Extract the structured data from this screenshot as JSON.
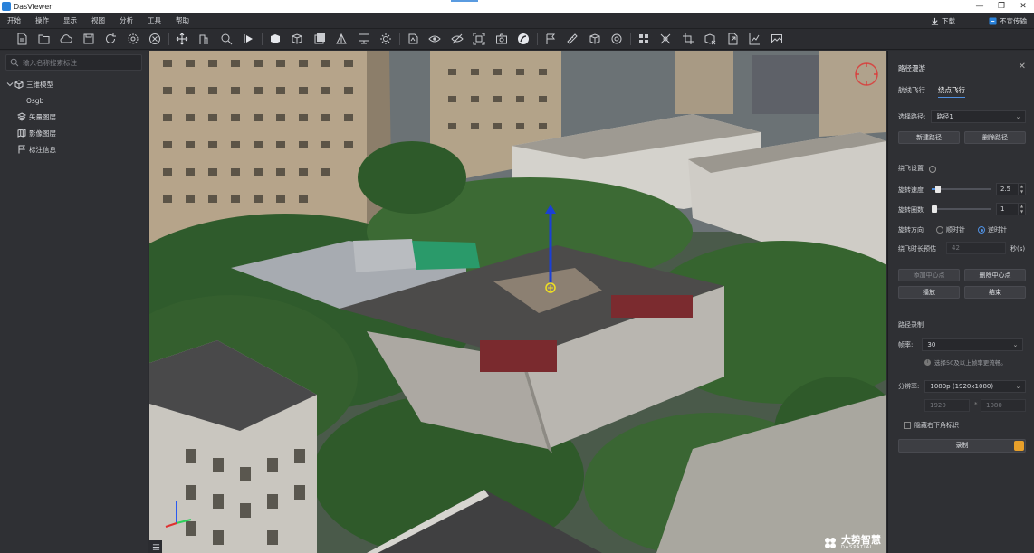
{
  "app": {
    "title": "DasViewer"
  },
  "menu": {
    "items": [
      "开始",
      "操作",
      "显示",
      "视图",
      "分析",
      "工具",
      "帮助"
    ],
    "download_label": "下载",
    "no_border_label": "不宣传输"
  },
  "toolbar": {
    "icons": [
      "new-file-icon",
      "open-folder-icon",
      "cloud-icon",
      "save-icon",
      "refresh-icon",
      "settings-icon",
      "close-circle-icon",
      "move-icon",
      "measure-building-icon",
      "zoom-icon",
      "play-path-icon",
      "cube-solid-icon",
      "cube-wire-icon",
      "cube-layers-icon",
      "pyramid-icon",
      "monitor-icon",
      "light-icon",
      "rotate-icon",
      "view-eye-icon",
      "view-hide-icon",
      "frame-icon",
      "camera-icon",
      "fly-path-icon",
      "flag-icon",
      "ruler-icon",
      "volume-icon",
      "target-icon",
      "grid-icon",
      "clip-icon",
      "crop-icon",
      "box-cut-icon",
      "export-icon",
      "chart-icon",
      "image-icon"
    ]
  },
  "left_panel": {
    "search_placeholder": "输入名称搜索标注",
    "tree": {
      "root": "三维模型",
      "child": "Osgb",
      "vector": "矢量图层",
      "imagery": "影像图层",
      "annotations": "标注信息"
    }
  },
  "viewport": {
    "watermark_main": "大势智慧",
    "watermark_sub": "DASPATIAL"
  },
  "right_panel": {
    "title": "路径漫游",
    "tabs": [
      "航线飞行",
      "绕点飞行"
    ],
    "active_tab": 1,
    "path_select_label": "选择路径:",
    "path_select_value": "路径1",
    "new_path": "新建路径",
    "delete_path": "删除路径",
    "fly_settings": "绕飞设置",
    "rotate_speed_label": "旋转速度",
    "rotate_speed_value": "2.5",
    "rotate_speed_fraction": 0.06,
    "rotate_count_label": "旋转圈数",
    "rotate_count_value": "1",
    "rotate_count_fraction": 0.0,
    "direction_label": "旋转方向",
    "direction_cw": "顺时针",
    "direction_ccw": "逆时针",
    "duration_label": "绕飞时长预估",
    "duration_value": "42",
    "duration_unit": "秒(s)",
    "add_center": "添加中心点",
    "delete_center": "删除中心点",
    "play": "播放",
    "stop": "结束",
    "record_title": "路径录制",
    "fps_label": "帧率:",
    "fps_value": "30",
    "fps_hint": "选择50及以上帧率更流畅。",
    "resolution_label": "分辨率:",
    "resolution_value": "1080p (1920x1080)",
    "res_width": "1920",
    "res_sep": "*",
    "res_height": "1080",
    "hide_corner_label": "隐藏右下角标识",
    "record_button": "录制"
  },
  "colors": {
    "accent": "#4f8fe0",
    "record": "#e8a02a"
  }
}
